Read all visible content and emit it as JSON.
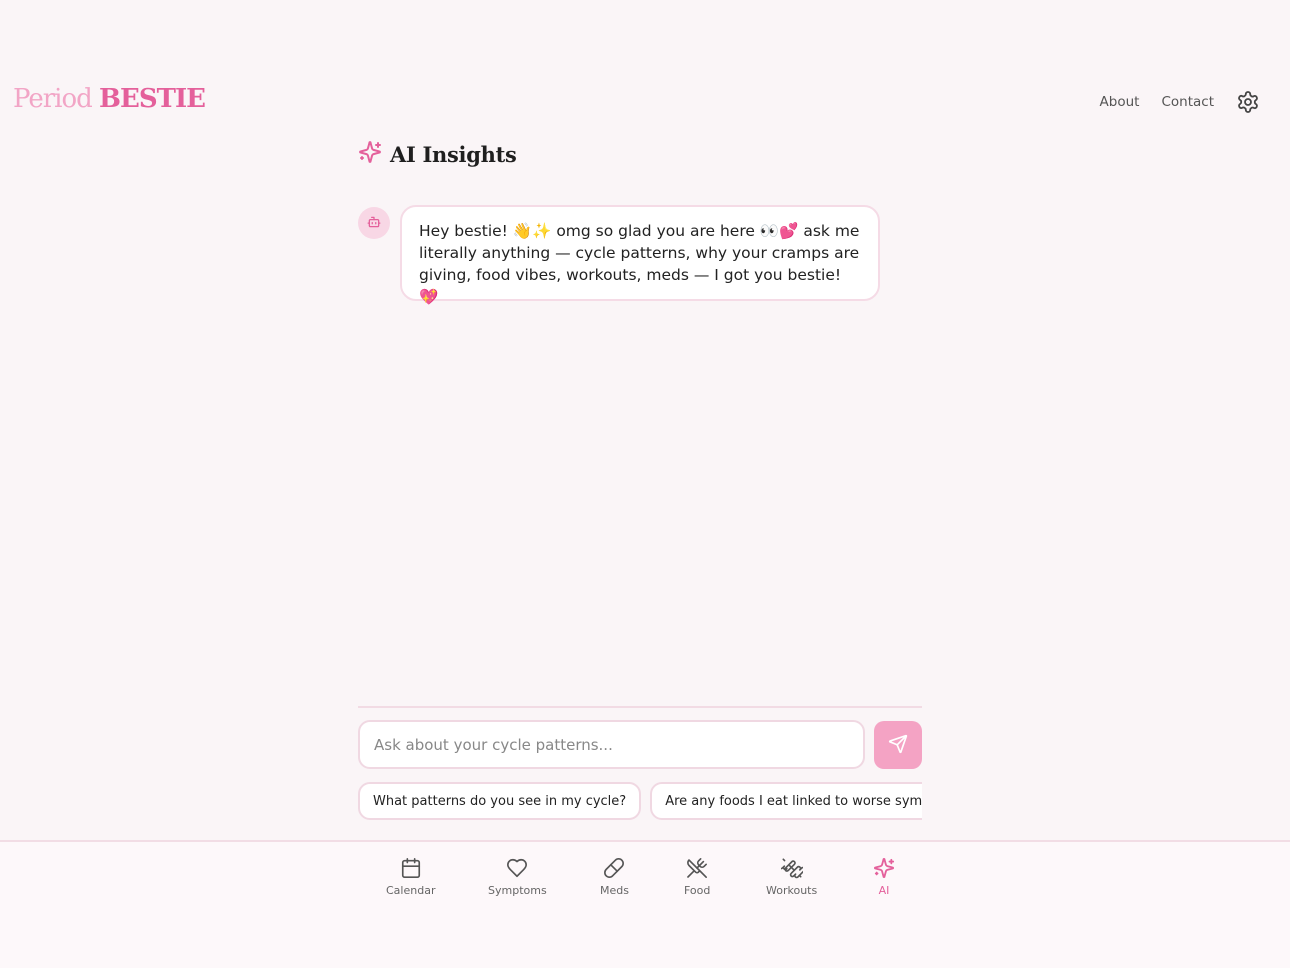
{
  "header": {
    "logo_light": "Period",
    "logo_bold": "BESTIE",
    "nav_about": "About",
    "nav_contact": "Contact",
    "settings_icon": "gear-icon"
  },
  "page": {
    "title": "AI Insights",
    "title_icon": "sparkles-icon"
  },
  "chat": {
    "messages": [
      {
        "sender": "bot",
        "avatar_icon": "bot-icon",
        "text": "Hey bestie! 👋✨ omg so glad you are here 👀💕 ask me literally anything — cycle patterns, why your cramps are giving, food vibes, workouts, meds — I got you bestie! 💖"
      }
    ],
    "input_placeholder": "Ask about your cycle patterns...",
    "input_value": "",
    "send_icon": "send-icon",
    "suggestions": [
      "What patterns do you see in my cycle?",
      "Are any foods I eat linked to worse symptoms?"
    ]
  },
  "bottom_nav": {
    "tabs": [
      {
        "label": "Calendar",
        "icon": "calendar-icon"
      },
      {
        "label": "Symptoms",
        "icon": "heart-icon"
      },
      {
        "label": "Meds",
        "icon": "pill-icon"
      },
      {
        "label": "Food",
        "icon": "utensils-icon"
      },
      {
        "label": "Workouts",
        "icon": "dumbbell-icon"
      },
      {
        "label": "AI",
        "icon": "sparkles-icon"
      }
    ],
    "active": "AI"
  },
  "colors": {
    "accent": "#e4609b",
    "accent_light": "#f2a5c6",
    "send_button": "#f4a3c4",
    "background": "#faf5f7",
    "border": "#f0d8e2"
  }
}
